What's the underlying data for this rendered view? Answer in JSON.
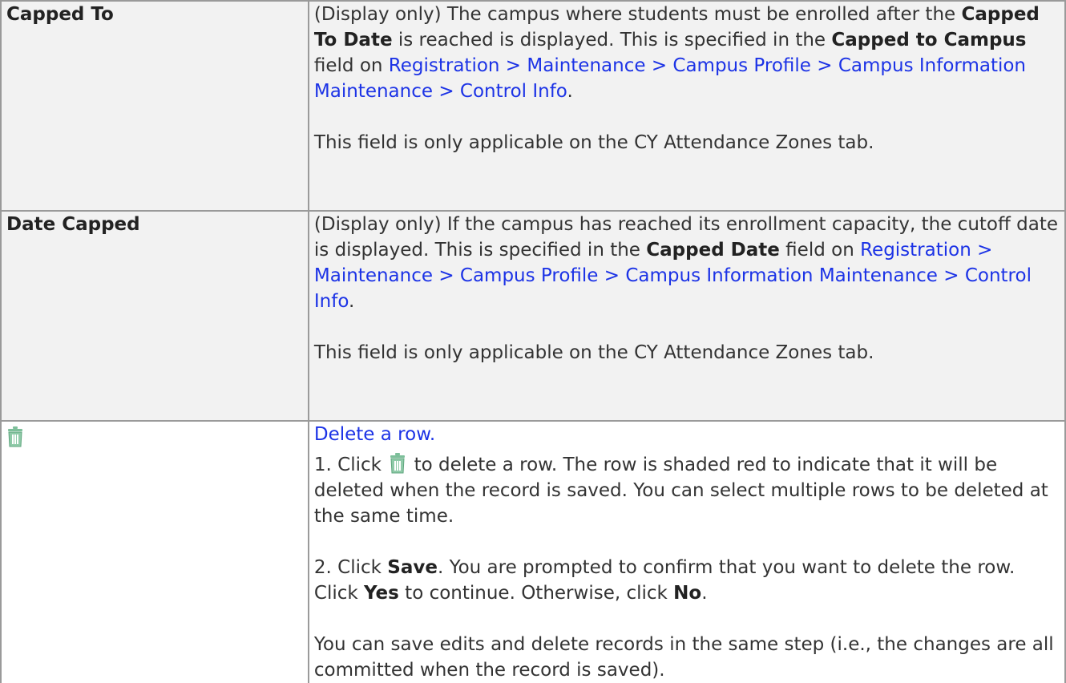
{
  "rows": [
    {
      "label": "Capped To",
      "desc_1a": "(Display only) The campus where students must be enrolled after the ",
      "desc_1b": "Capped To Date",
      "desc_1c": " is reached is displayed. This is specified in the ",
      "desc_1d": "Capped to Campus",
      "desc_1e": " field on ",
      "link": "Registration > Maintenance > Campus Profile > Campus Information Maintenance > Control Info",
      "desc_1f": ".",
      "desc_2": "This field is only applicable on the CY Attendance Zones tab."
    },
    {
      "label": "Date Capped",
      "desc_1a": "(Display only) If the campus has reached its enrollment capacity, the cutoff date is displayed. This is specified in the ",
      "desc_1b": "Capped Date",
      "desc_1c": " field on ",
      "link": "Registration > Maintenance > Campus Profile > Campus Information Maintenance > Control Info",
      "desc_1d": ".",
      "desc_2": "This field is only applicable on the CY Attendance Zones tab."
    },
    {
      "icon": "trash-icon",
      "link": "Delete a row.",
      "step1_a": "1. Click ",
      "step1_b": " to delete a row. The row is shaded red to indicate that it will be deleted when the record is saved. You can select multiple rows to be deleted at the same time.",
      "step2_a": "2. Click ",
      "step2_b": "Save",
      "step2_c": ". You are prompted to confirm that you want to delete the row. Click ",
      "step2_d": "Yes",
      "step2_e": " to continue. Otherwise, click ",
      "step2_f": "No",
      "step2_g": ".",
      "note": "You can save edits and delete records in the same step (i.e., the changes are all committed when the record is saved)."
    }
  ],
  "colors": {
    "link": "#1c33e6",
    "shaded_row": "#f2f2f2",
    "border": "#9a9a9a",
    "icon": "#7dbf9a"
  }
}
